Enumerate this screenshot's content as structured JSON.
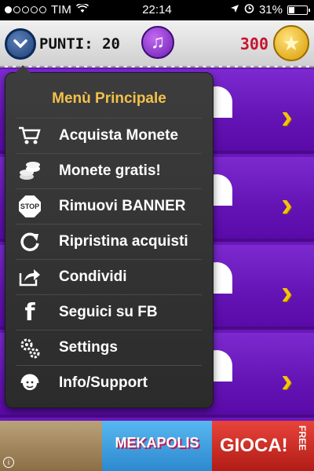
{
  "status_bar": {
    "carrier": "TIM",
    "time": "22:14",
    "battery_percent": "31%",
    "battery_level": 0.31
  },
  "header": {
    "points_label": "PUNTI: 20",
    "coins_value": "300",
    "menu_icon": "chevron-down-icon",
    "music_icon": "music-note-icon",
    "coin_icon": "star-coin-icon"
  },
  "menu": {
    "title": "Menù Principale",
    "items": [
      {
        "label": "Acquista Monete",
        "icon": "cart-icon"
      },
      {
        "label": "Monete gratis!",
        "icon": "coins-icon"
      },
      {
        "label": "Rimuovi BANNER",
        "icon": "stop-sign-icon"
      },
      {
        "label": "Ripristina acquisti",
        "icon": "restore-icon"
      },
      {
        "label": "Condividi",
        "icon": "share-icon"
      },
      {
        "label": "Seguici su FB",
        "icon": "facebook-icon"
      },
      {
        "label": "Settings",
        "icon": "gears-icon"
      },
      {
        "label": "Info/Support",
        "icon": "support-icon"
      }
    ]
  },
  "banner": {
    "brand": "MEKAPOLIS",
    "cta": "GIOCA!",
    "free": "FREE",
    "stop_text": "STOP"
  },
  "colors": {
    "background": "#6a16b8",
    "menu_title": "#f2c14a",
    "coins_value": "#c6142e",
    "arrow": "#f4c20d"
  }
}
